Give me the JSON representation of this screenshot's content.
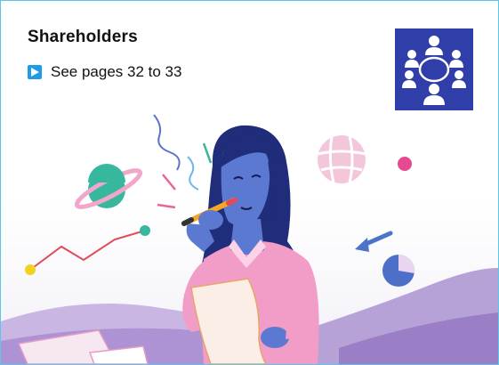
{
  "section": {
    "title": "Shareholders",
    "link_text": "See pages 32 to 33"
  },
  "icons": {
    "link_icon": "play-arrow-icon",
    "section_icon": "meeting-table-icon"
  },
  "colors": {
    "border": "#5cc6e8",
    "link_badge": "#1e9be8",
    "tile": "#2f3ea8",
    "skin": "#5c79d2",
    "hair": "#1f2d7a",
    "shirt": "#f29cc8",
    "ground": "#b7a2d8"
  }
}
